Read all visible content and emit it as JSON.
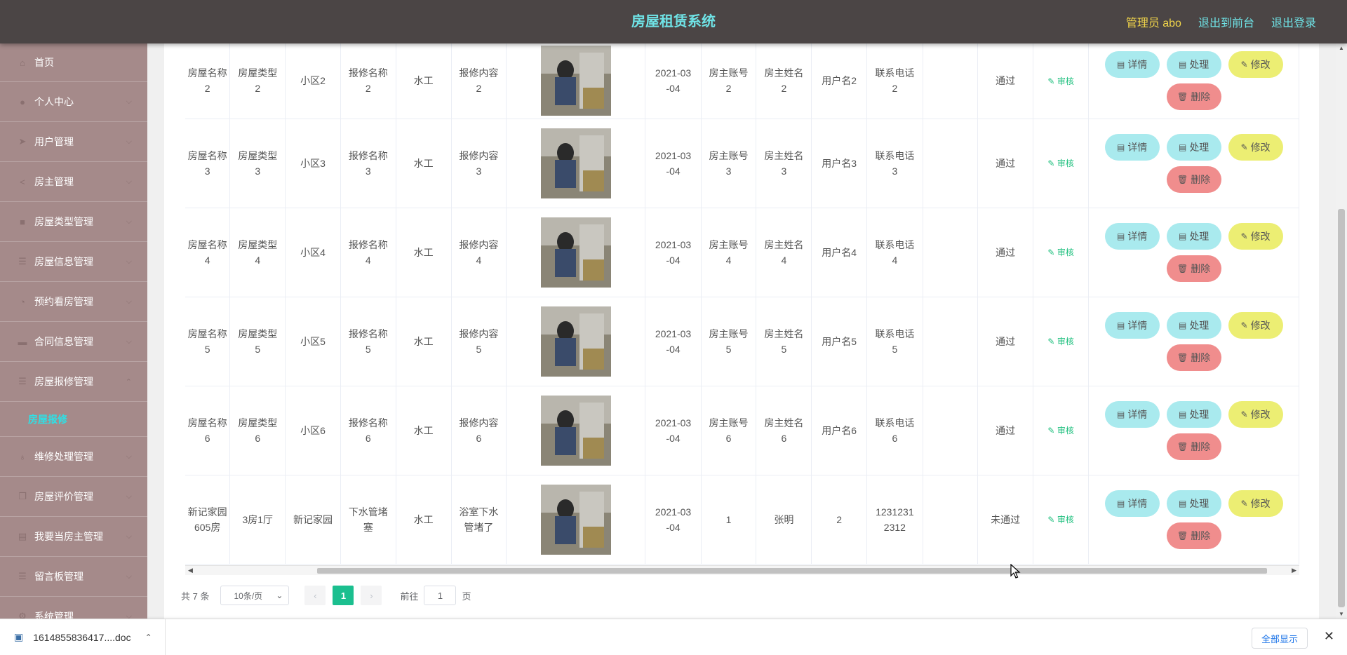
{
  "header": {
    "title": "房屋租赁系统",
    "admin_label": "管理员 abo",
    "front_link": "退出到前台",
    "logout_link": "退出登录"
  },
  "sidebar": {
    "items": [
      {
        "label": "首页",
        "icon": "home-icon"
      },
      {
        "label": "个人中心",
        "icon": "user-icon"
      },
      {
        "label": "用户管理",
        "icon": "send-icon"
      },
      {
        "label": "房主管理",
        "icon": "share-icon"
      },
      {
        "label": "房屋类型管理",
        "icon": "box-icon"
      },
      {
        "label": "房屋信息管理",
        "icon": "list-icon"
      },
      {
        "label": "预约看房管理",
        "icon": "clock-icon"
      },
      {
        "label": "合同信息管理",
        "icon": "chat-icon"
      },
      {
        "label": "房屋报修管理",
        "icon": "list-icon"
      },
      {
        "label": "维修处理管理",
        "icon": "bulb-icon"
      },
      {
        "label": "房屋评价管理",
        "icon": "copy-icon"
      },
      {
        "label": "我要当房主管理",
        "icon": "document-icon"
      },
      {
        "label": "留言板管理",
        "icon": "list-icon"
      },
      {
        "label": "系统管理",
        "icon": "gear-icon"
      }
    ],
    "active_sub": "房屋报修"
  },
  "table": {
    "rows": [
      {
        "name": "房屋名称\n2",
        "type": "房屋类型\n2",
        "community": "小区2",
        "repair_name": "报修名称\n2",
        "repair_type": "水工",
        "repair_content": "报修内容\n2",
        "date": "2021-03\n-04",
        "owner_account": "房主账号\n2",
        "owner_name": "房主姓名\n2",
        "username": "用户名2",
        "phone": "联系电话\n2",
        "empty": "",
        "status": "通过",
        "audit": "审核"
      },
      {
        "name": "房屋名称\n3",
        "type": "房屋类型\n3",
        "community": "小区3",
        "repair_name": "报修名称\n3",
        "repair_type": "水工",
        "repair_content": "报修内容\n3",
        "date": "2021-03\n-04",
        "owner_account": "房主账号\n3",
        "owner_name": "房主姓名\n3",
        "username": "用户名3",
        "phone": "联系电话\n3",
        "empty": "",
        "status": "通过",
        "audit": "审核"
      },
      {
        "name": "房屋名称\n4",
        "type": "房屋类型\n4",
        "community": "小区4",
        "repair_name": "报修名称\n4",
        "repair_type": "水工",
        "repair_content": "报修内容\n4",
        "date": "2021-03\n-04",
        "owner_account": "房主账号\n4",
        "owner_name": "房主姓名\n4",
        "username": "用户名4",
        "phone": "联系电话\n4",
        "empty": "",
        "status": "通过",
        "audit": "审核"
      },
      {
        "name": "房屋名称\n5",
        "type": "房屋类型\n5",
        "community": "小区5",
        "repair_name": "报修名称\n5",
        "repair_type": "水工",
        "repair_content": "报修内容\n5",
        "date": "2021-03\n-04",
        "owner_account": "房主账号\n5",
        "owner_name": "房主姓名\n5",
        "username": "用户名5",
        "phone": "联系电话\n5",
        "empty": "",
        "status": "通过",
        "audit": "审核"
      },
      {
        "name": "房屋名称\n6",
        "type": "房屋类型\n6",
        "community": "小区6",
        "repair_name": "报修名称\n6",
        "repair_type": "水工",
        "repair_content": "报修内容\n6",
        "date": "2021-03\n-04",
        "owner_account": "房主账号\n6",
        "owner_name": "房主姓名\n6",
        "username": "用户名6",
        "phone": "联系电话\n6",
        "empty": "",
        "status": "通过",
        "audit": "审核"
      },
      {
        "name": "新记家园\n605房",
        "type": "3房1厅",
        "community": "新记家园",
        "repair_name": "下水管堵\n塞",
        "repair_type": "水工",
        "repair_content": "浴室下水\n管堵了",
        "date": "2021-03\n-04",
        "owner_account": "1",
        "owner_name": "张明",
        "username": "2",
        "phone": "1231231\n2312",
        "empty": "",
        "status": "未通过",
        "audit": "审核"
      }
    ],
    "buttons": {
      "detail": "详情",
      "handle": "处理",
      "edit": "修改",
      "delete": "删除"
    }
  },
  "pagination": {
    "total": "共 7 条",
    "page_size": "10条/页",
    "current_page": "1",
    "goto_label": "前往",
    "goto_value": "1",
    "page_suffix": "页"
  },
  "download_bar": {
    "file_name": "1614855836417....doc",
    "show_all": "全部显示"
  }
}
